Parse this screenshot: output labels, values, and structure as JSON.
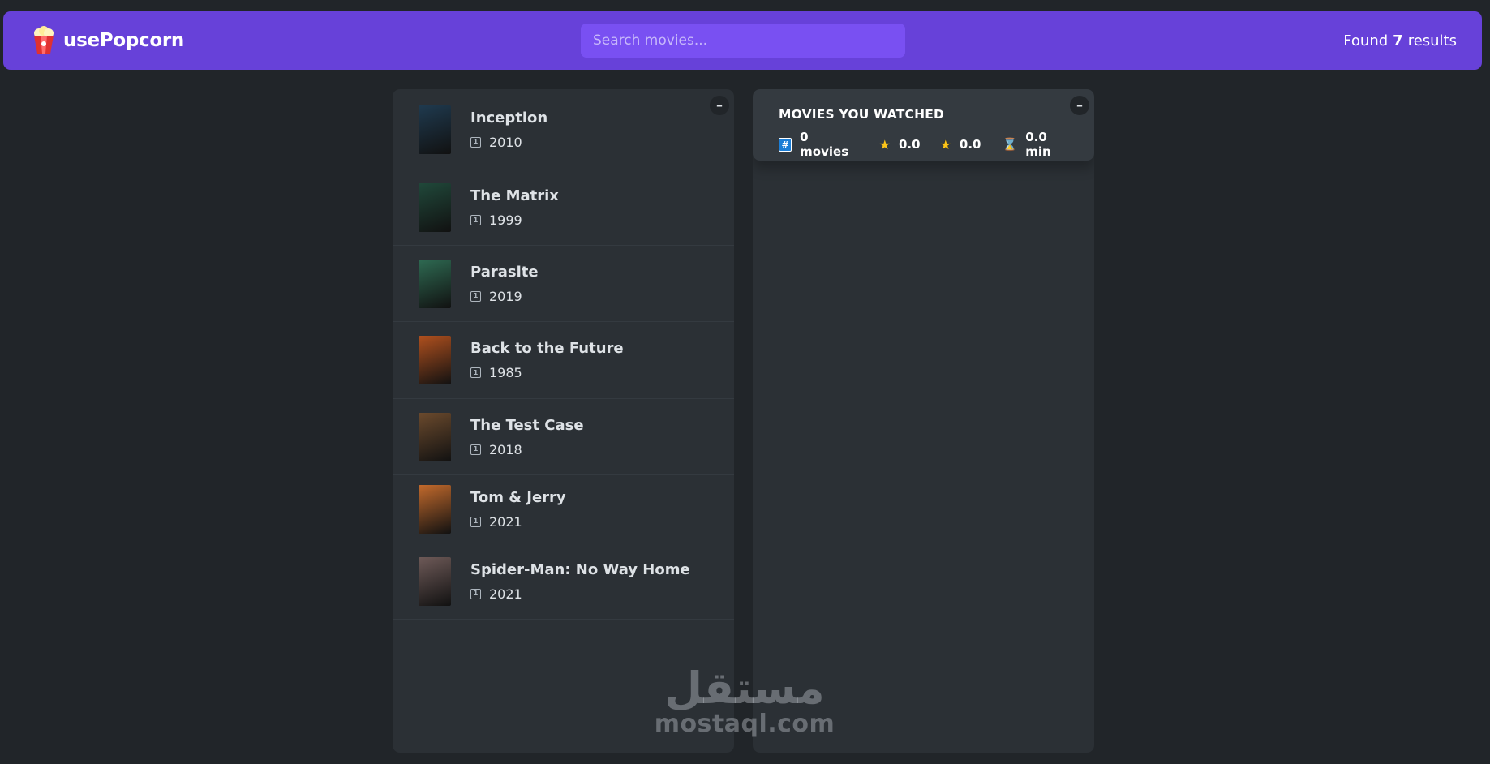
{
  "navbar": {
    "logo_text": "usePopcorn",
    "search_placeholder": "Search movies...",
    "results_prefix": "Found",
    "results_count": "7",
    "results_suffix": "results"
  },
  "movie_list": {
    "toggle_label": "–",
    "movies": [
      {
        "title": "Inception",
        "year": "2010",
        "poster_color": "#1f3a4f"
      },
      {
        "title": "The Matrix",
        "year": "1999",
        "poster_color": "#20483a"
      },
      {
        "title": "Parasite",
        "year": "2019",
        "poster_color": "#2e6a52"
      },
      {
        "title": "Back to the Future",
        "year": "1985",
        "poster_color": "#b0501e"
      },
      {
        "title": "The Test Case",
        "year": "2018",
        "poster_color": "#6b4a2d"
      },
      {
        "title": "Tom & Jerry",
        "year": "2021",
        "poster_color": "#c36a2c"
      },
      {
        "title": "Spider-Man: No Way Home",
        "year": "2021",
        "poster_color": "#6e5a58"
      }
    ]
  },
  "watched": {
    "toggle_label": "–",
    "heading": "Movies you watched",
    "count_label": "0 movies",
    "imdb_rating": "0.0",
    "user_rating": "0.0",
    "runtime": "0.0 min"
  },
  "watermark": {
    "arabic": "مستقل",
    "latin": "mostaql.com"
  }
}
